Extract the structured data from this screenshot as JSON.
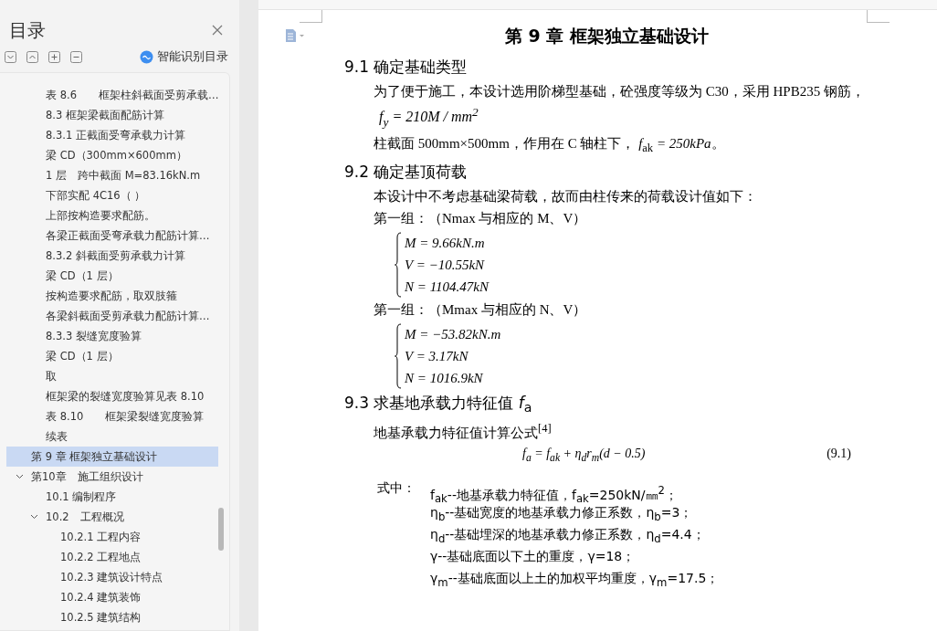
{
  "sidebar": {
    "title": "目录",
    "smart_toc_label": "智能识别目录",
    "continued_items": [
      {
        "label": "表 8.6　　框架柱斜截面受剪承载…",
        "selected": false
      },
      {
        "label": "8.3 框架梁截面配筋计算",
        "selected": false
      },
      {
        "label": "8.3.1 正截面受弯承载力计算",
        "selected": false
      },
      {
        "label": "梁 CD（300mm×600mm）",
        "selected": false
      },
      {
        "label": "1 层　跨中截面  M=83.16kN.m",
        "selected": false
      },
      {
        "label": "下部实配 4C16（ ）",
        "selected": false
      },
      {
        "label": "上部按构造要求配筋。",
        "selected": false
      },
      {
        "label": "各梁正截面受弯承载力配筋计算…",
        "selected": false
      },
      {
        "label": "8.3.2 斜截面受剪承载力计算",
        "selected": false
      },
      {
        "label": "梁 CD（1 层）",
        "selected": false
      },
      {
        "label": "按构造要求配筋，取双肢箍",
        "selected": false
      },
      {
        "label": "各梁斜截面受剪承载力配筋计算…",
        "selected": false
      },
      {
        "label": "8.3.3 裂缝宽度验算",
        "selected": false
      },
      {
        "label": "梁 CD（1 层）",
        "selected": false
      },
      {
        "label": "取",
        "selected": false
      },
      {
        "label": "框架梁的裂缝宽度验算见表 8.10",
        "selected": false
      },
      {
        "label": "表 8.10　　框架梁裂缝宽度验算",
        "selected": false
      },
      {
        "label": "续表",
        "selected": false
      }
    ],
    "chapters": [
      {
        "label": "第 9 章  框架独立基础设计",
        "selected": true
      },
      {
        "label": "第10章　施工组织设计",
        "selected": false,
        "expanded": true,
        "children": [
          {
            "label": "10.1  编制程序",
            "selected": false
          },
          {
            "label": "10.2　工程概况",
            "selected": false,
            "expanded": true,
            "children": [
              {
                "label": "10.2.1  工程内容",
                "selected": false
              },
              {
                "label": "10.2.2  工程地点",
                "selected": false
              },
              {
                "label": "10.2.3  建筑设计特点",
                "selected": false
              },
              {
                "label": "10.2.4  建筑装饰",
                "selected": false
              },
              {
                "label": "10.2.5  建筑结构",
                "selected": false
              }
            ]
          }
        ]
      }
    ]
  },
  "document": {
    "chapter_title": "第 9 章  框架独立基础设计",
    "sections": [
      {
        "heading": "9.1 确定基础类型",
        "blocks": [
          {
            "kind": "text",
            "text": "为了便于施工，本设计选用阶梯型基础，砼强度等级为 C30，采用 HPB235 钢筋，"
          },
          {
            "kind": "formula",
            "text": "f$_{y}$ = 210M / mm$^{2}$"
          },
          {
            "kind": "text",
            "text": "柱截面 500mm×500mm，作用在 C 轴柱下， *f*$_{ak}$ *= 250kPa*。"
          }
        ]
      },
      {
        "heading": "9.2 确定基顶荷载",
        "blocks": [
          {
            "kind": "text",
            "text": "本设计中不考虑基础梁荷载，故而由柱传来的荷载设计值如下："
          },
          {
            "kind": "text",
            "text": "第一组：（Nmax 与相应的 M、V）"
          },
          {
            "kind": "system",
            "lines": [
              "M = 9.66kN.m",
              "V = −10.55kN",
              "N = 1104.47kN"
            ]
          },
          {
            "kind": "text",
            "text": "第一组：（Mmax 与相应的 N、V）"
          },
          {
            "kind": "system",
            "lines": [
              "M = −53.82kN.m",
              "V = 3.17kN",
              "N = 1016.9kN"
            ]
          }
        ]
      },
      {
        "heading": "9.3 求基地承载力特征值 *f*$_{a}$",
        "blocks": [
          {
            "kind": "text",
            "text": "地基承载力特征值计算公式$^{[4]}$"
          },
          {
            "kind": "equation",
            "text": "f$_{a}$ = f$_{ak}$ + η$_{d}$r$_{m}$(d − 0.5)",
            "number": "(9.1)"
          },
          {
            "kind": "where",
            "label": "式中：",
            "lines": [
              "f$_{ak}$--地基承载力特征值，f$_{ak}$=250kN/㎜$^{2}$；",
              "η$_{b}$--基础宽度的地基承载力修正系数，η$_{b}$=3；",
              "η$_{d}$--基础埋深的地基承载力修正系数，η$_{d}$=4.4；",
              "γ--基础底面以下土的重度，γ=18；",
              "γ$_{m}$--基础底面以上土的加权平均重度，γ$_{m}$=17.5；"
            ]
          }
        ]
      }
    ]
  }
}
